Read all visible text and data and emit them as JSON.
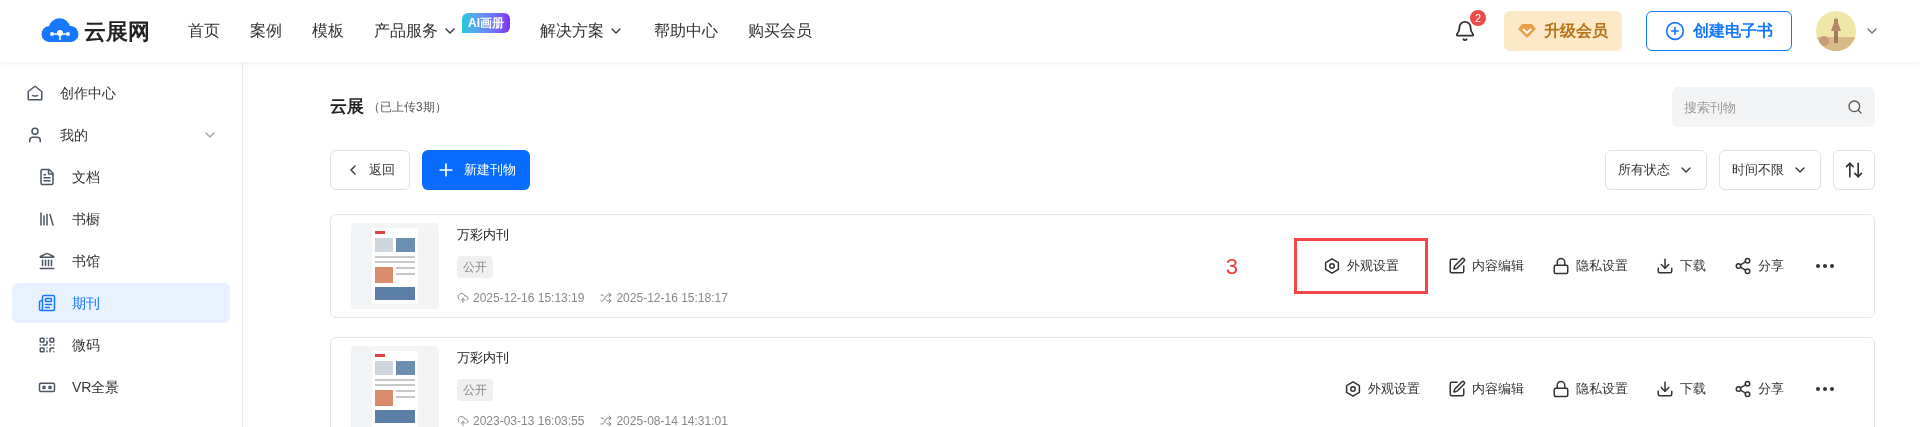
{
  "header": {
    "logo": "云展网",
    "nav": [
      {
        "label": "首页",
        "dropdown": false
      },
      {
        "label": "案例",
        "dropdown": false
      },
      {
        "label": "模板",
        "dropdown": false
      },
      {
        "label": "产品服务",
        "dropdown": true,
        "badge": "AI画册"
      },
      {
        "label": "解决方案",
        "dropdown": true
      },
      {
        "label": "帮助中心",
        "dropdown": false
      },
      {
        "label": "购买会员",
        "dropdown": false
      }
    ],
    "notifications": "2",
    "upgrade_button": "升级会员",
    "create_button": "创建电子书"
  },
  "sidebar": {
    "items": [
      {
        "label": "创作中心",
        "kind": "home",
        "selected": false
      },
      {
        "label": "我的",
        "kind": "user",
        "selected": false,
        "expanded": true,
        "children": [
          {
            "label": "文档",
            "kind": "document",
            "selected": false
          },
          {
            "label": "书橱",
            "kind": "bookshelf",
            "selected": false
          },
          {
            "label": "书馆",
            "kind": "library",
            "selected": false
          },
          {
            "label": "期刊",
            "kind": "magazine",
            "selected": true
          },
          {
            "label": "微码",
            "kind": "qrcode",
            "selected": false
          },
          {
            "label": "VR全景",
            "kind": "vr",
            "selected": false
          }
        ]
      }
    ]
  },
  "main": {
    "title": "云展",
    "subtitle": "（已上传3期）",
    "search": {
      "placeholder": "搜索刊物"
    },
    "back_button": "返回",
    "new_button": "新建刊物",
    "filters": [
      {
        "label": "所有状态"
      },
      {
        "label": "时间不限"
      }
    ],
    "items": [
      {
        "title": "万彩内刊",
        "status": "公开",
        "created": "2025-12-16 15:13:19",
        "updated": "2025-12-16 15:18:17",
        "annotation": "3",
        "actions": [
          {
            "kind": "appearance",
            "label": "外观设置",
            "highlighted": true
          },
          {
            "kind": "edit",
            "label": "内容编辑",
            "highlighted": false
          },
          {
            "kind": "privacy",
            "label": "隐私设置",
            "highlighted": false
          },
          {
            "kind": "download",
            "label": "下载",
            "highlighted": false
          },
          {
            "kind": "share",
            "label": "分享",
            "highlighted": false
          },
          {
            "kind": "more",
            "highlighted": false
          }
        ]
      },
      {
        "title": "万彩内刊",
        "status": "公开",
        "created": "2023-03-13 16:03:55",
        "updated": "2025-08-14 14:31:01",
        "actions": [
          {
            "kind": "appearance",
            "label": "外观设置",
            "highlighted": false
          },
          {
            "kind": "edit",
            "label": "内容编辑",
            "highlighted": false
          },
          {
            "kind": "privacy",
            "label": "隐私设置",
            "highlighted": false
          },
          {
            "kind": "download",
            "label": "下载",
            "highlighted": false
          },
          {
            "kind": "share",
            "label": "分享",
            "highlighted": false
          },
          {
            "kind": "more",
            "highlighted": false
          }
        ]
      }
    ]
  }
}
